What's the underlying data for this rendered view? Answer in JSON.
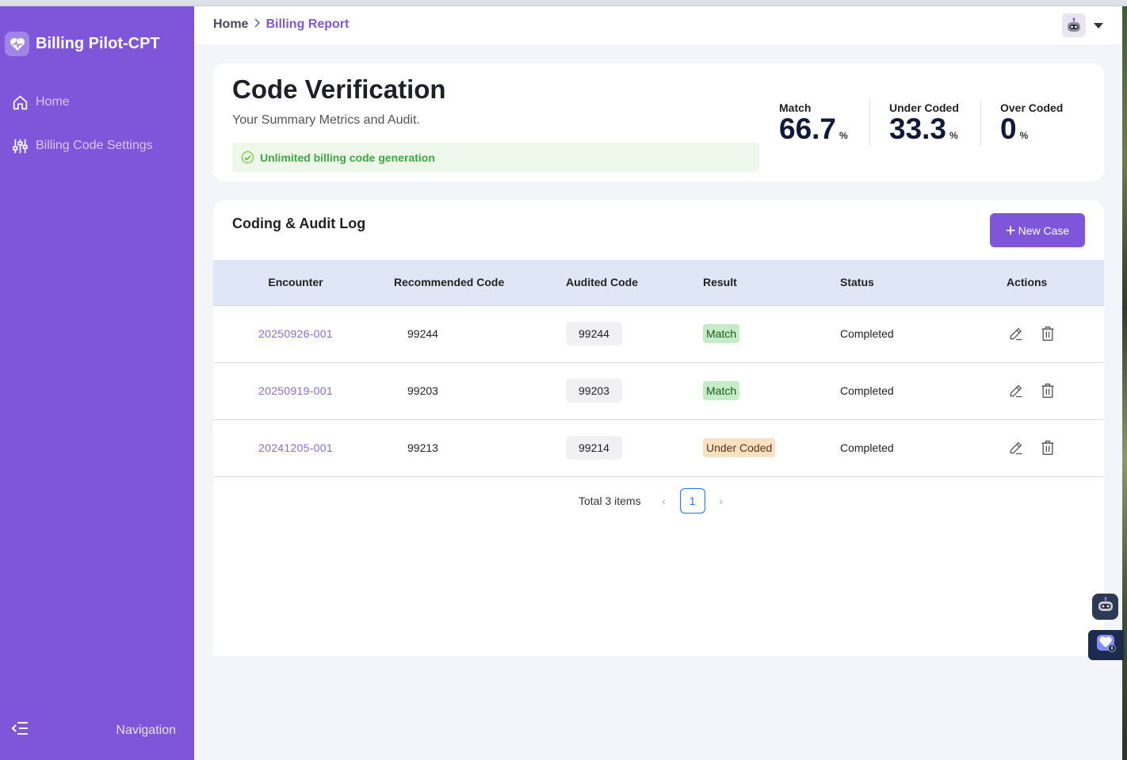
{
  "app": {
    "brand": "Billing Pilot-CPT",
    "nav": [
      {
        "label": "Home",
        "icon": "home-icon"
      },
      {
        "label": "Billing Code Settings",
        "icon": "sliders-icon"
      }
    ],
    "collapse_label": "Navigation"
  },
  "header": {
    "breadcrumb": {
      "home": "Home",
      "current": "Billing Report"
    },
    "avatar_icon": "robot-avatar-icon"
  },
  "summary": {
    "title": "Code Verification",
    "subtitle": "Your Summary Metrics and Audit.",
    "banner": "Unlimited billing code generation",
    "metrics": [
      {
        "label": "Match",
        "value": "66.7",
        "unit": "%"
      },
      {
        "label": "Under Coded",
        "value": "33.3",
        "unit": "%"
      },
      {
        "label": "Over Coded",
        "value": "0",
        "unit": "%"
      }
    ]
  },
  "log": {
    "title": "Coding & Audit Log",
    "new_button": "New Case",
    "columns": [
      "Encounter",
      "Recommended Code",
      "Audited Code",
      "Result",
      "Status",
      "Actions"
    ],
    "rows": [
      {
        "encounter": "20250926-001",
        "recommended": "99244",
        "audited": "99244",
        "result": "Match",
        "status": "Completed"
      },
      {
        "encounter": "20250919-001",
        "recommended": "99203",
        "audited": "99203",
        "result": "Match",
        "status": "Completed"
      },
      {
        "encounter": "20241205-001",
        "recommended": "99213",
        "audited": "99214",
        "result": "Under Coded",
        "status": "Completed"
      }
    ],
    "pagination": {
      "total_text": "Total 3 items",
      "current_page": "1"
    }
  },
  "colors": {
    "sidebar": "#7f56d9",
    "accent": "#7f56d9",
    "match_badge": "#c6ecc7",
    "under_badge": "#fbe0c3",
    "table_header": "#dfe7f7"
  }
}
